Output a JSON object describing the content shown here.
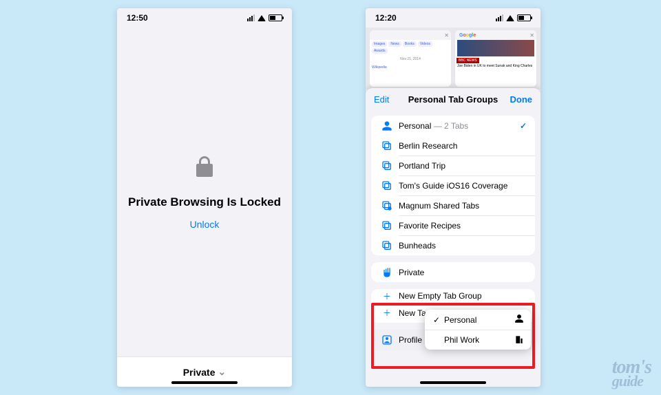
{
  "left": {
    "time": "12:50",
    "title": "Private Browsing Is Locked",
    "unlock": "Unlock",
    "tab_label": "Private"
  },
  "right": {
    "time": "12:20",
    "thumb1": {
      "tags": [
        "Images",
        "News",
        "Books",
        "Videos",
        "Awards"
      ],
      "date": "Nov 21, 2014",
      "wikiline": "Wikipedia"
    },
    "thumb2": {
      "logo": "Google News",
      "source": "BBC NEWS",
      "headline": "Joe Biden in UK to meet Sunak and King Charles"
    },
    "sheet": {
      "edit": "Edit",
      "title": "Personal Tab Groups",
      "done": "Done",
      "personal_label": "Personal",
      "personal_meta": " — 2 Tabs",
      "groups": [
        "Berlin Research",
        "Portland Trip",
        "Tom's Guide iOS16 Coverage",
        "Magnum Shared Tabs",
        "Favorite Recipes",
        "Bunheads"
      ],
      "private": "Private",
      "new_empty": "New Empty Tab Group",
      "new_tab_group_truncated": "New Ta",
      "profile_label": "Profile",
      "profile_value": "Personal",
      "popover": {
        "opt1": "Personal",
        "opt2": "Phil Work"
      }
    }
  },
  "watermark": {
    "line1": "tom's",
    "line2": "guide"
  }
}
